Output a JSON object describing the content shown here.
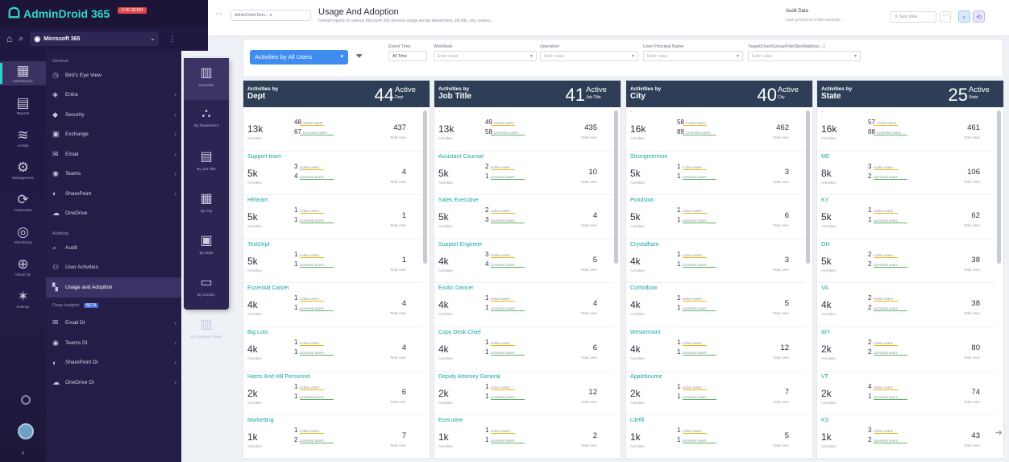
{
  "brand": {
    "name": "AdminDroid 365",
    "badge": "LIVE DEMO"
  },
  "tenant": {
    "name": "Microsoft 365"
  },
  "rail": [
    {
      "label": "Dashboards",
      "icon": "dashboard-icon",
      "glyph": "▦"
    },
    {
      "label": "Reports",
      "icon": "reports-icon",
      "glyph": "▤"
    },
    {
      "label": "Activity",
      "icon": "activity-icon",
      "glyph": "≋"
    },
    {
      "label": "Management",
      "icon": "management-icon",
      "glyph": "⚙"
    },
    {
      "label": "Automation",
      "icon": "automation-icon",
      "glyph": "⟳"
    },
    {
      "label": "Monitoring",
      "icon": "monitoring-icon",
      "glyph": "◎"
    },
    {
      "label": "Virtual DL",
      "icon": "virtual-dl-icon",
      "glyph": "⊕"
    },
    {
      "label": "Settings",
      "icon": "settings-icon",
      "glyph": "✶"
    }
  ],
  "menu": {
    "section1": "General",
    "items1": [
      {
        "label": "Bird's Eye View",
        "glyph": "◷",
        "arrow": false
      },
      {
        "label": "Entra",
        "glyph": "◈",
        "arrow": true
      },
      {
        "label": "Security",
        "glyph": "◆",
        "arrow": true
      },
      {
        "label": "Exchange",
        "glyph": "▣",
        "arrow": true
      },
      {
        "label": "Email",
        "glyph": "✉",
        "arrow": true
      },
      {
        "label": "Teams",
        "glyph": "◉",
        "arrow": true
      },
      {
        "label": "SharePoint",
        "glyph": "◐",
        "arrow": true
      },
      {
        "label": "OneDrive",
        "glyph": "☁",
        "arrow": false
      }
    ],
    "section2": "Auditing",
    "items2": [
      {
        "label": "Audit",
        "glyph": "⌕",
        "arrow": false
      },
      {
        "label": "User Activities",
        "glyph": "⚇",
        "arrow": false
      },
      {
        "label": "Usage and Adoption",
        "glyph": "▚",
        "arrow": false
      }
    ],
    "section3": "Deep Insights",
    "section3_badge": "BETA",
    "items3": [
      {
        "label": "Email DI",
        "glyph": "✉",
        "arrow": true
      },
      {
        "label": "Teams DI",
        "glyph": "◉",
        "arrow": true
      },
      {
        "label": "SharePoint DI",
        "glyph": "◐",
        "arrow": true
      },
      {
        "label": "OneDrive DI",
        "glyph": "☁",
        "arrow": true
      }
    ]
  },
  "flyout": [
    {
      "label": "Overview",
      "glyph": "▥"
    },
    {
      "label": "By Department",
      "glyph": "⛬"
    },
    {
      "label": "By Job Title",
      "glyph": "▤"
    },
    {
      "label": "By City",
      "glyph": "▦"
    },
    {
      "label": "By State",
      "glyph": "▣"
    },
    {
      "label": "By Country",
      "glyph": "▭"
    },
    {
      "label": "By Company Name",
      "glyph": "▥"
    }
  ],
  "header": {
    "nav": "‹ ›",
    "breadcrumb": "AdminDroid Dem... ▾",
    "title": "Usage And Adoption",
    "description": "Overall reports on various Microsoft 365 services usage across department, job title, city, country...",
    "audit_title": "Audit Data",
    "audit_sub": "Last synced on a few seconds ...",
    "sync_label": "⟳ Sync Now",
    "more": "⋯",
    "btn1": "⌕",
    "btn2": "⟲"
  },
  "filters": {
    "view": "Activities by All Users",
    "event_time": {
      "label": "Event Time",
      "value": "All Time"
    },
    "workload": {
      "label": "Workload",
      "placeholder": "Enter value"
    },
    "operation": {
      "label": "Operation",
      "placeholder": "Enter value"
    },
    "upn": {
      "label": "User Principal Name",
      "placeholder": "Enter value"
    },
    "target": {
      "label": "Target(User/Group/File/Site/Mailbox/...)",
      "placeholder": "Enter value"
    }
  },
  "cards": [
    {
      "title1": "Activities by",
      "title2": "Dept",
      "count": "44",
      "count_label": "Active",
      "count_sub": "Dept",
      "rows": [
        {
          "name": "-",
          "act": "13k",
          "au": "48",
          "lu": "67",
          "tu": "437"
        },
        {
          "name": "Support team",
          "act": "5k",
          "au": "3",
          "lu": "4",
          "tu": "4"
        },
        {
          "name": "HRteam",
          "act": "5k",
          "au": "1",
          "lu": "1",
          "tu": "1"
        },
        {
          "name": "TestDept",
          "act": "5k",
          "au": "1",
          "lu": "1",
          "tu": "1"
        },
        {
          "name": "Essential Carpet",
          "act": "4k",
          "au": "1",
          "lu": "1",
          "tu": "4"
        },
        {
          "name": "Big Lots",
          "act": "4k",
          "au": "1",
          "lu": "1",
          "tu": "4"
        },
        {
          "name": "Harris And Hill Personnel",
          "act": "2k",
          "au": "1",
          "lu": "1",
          "tu": "6"
        },
        {
          "name": "Marketting",
          "act": "1k",
          "au": "1",
          "lu": "2",
          "tu": "7"
        }
      ]
    },
    {
      "title1": "Activities by",
      "title2": "Job Title",
      "count": "41",
      "count_label": "Active",
      "count_sub": "Job Title",
      "rows": [
        {
          "name": "-",
          "act": "13k",
          "au": "49",
          "lu": "58",
          "tu": "435"
        },
        {
          "name": "Assistant Counsel",
          "act": "5k",
          "au": "2",
          "lu": "1",
          "tu": "10"
        },
        {
          "name": "Sales Executive",
          "act": "5k",
          "au": "2",
          "lu": "3",
          "tu": "4"
        },
        {
          "name": "Support Engineer",
          "act": "4k",
          "au": "3",
          "lu": "4",
          "tu": "5"
        },
        {
          "name": "Exotic Dancer",
          "act": "4k",
          "au": "1",
          "lu": "1",
          "tu": "4"
        },
        {
          "name": "Copy Desk Chief",
          "act": "4k",
          "au": "1",
          "lu": "1",
          "tu": "6"
        },
        {
          "name": "Deputy Attorney General",
          "act": "2k",
          "au": "1",
          "lu": "1",
          "tu": "12"
        },
        {
          "name": "Executive",
          "act": "1k",
          "au": "1",
          "lu": "1",
          "tu": "2"
        }
      ]
    },
    {
      "title1": "Activities by",
      "title2": "City",
      "count": "40",
      "count_label": "Active",
      "count_sub": "City",
      "rows": [
        {
          "name": "-",
          "act": "16k",
          "au": "58",
          "lu": "89",
          "tu": "462"
        },
        {
          "name": "Strongmermoe",
          "act": "5k",
          "au": "1",
          "lu": "1",
          "tu": "3"
        },
        {
          "name": "Pondston",
          "act": "5k",
          "au": "1",
          "lu": "1",
          "tu": "6"
        },
        {
          "name": "Crystalham",
          "act": "4k",
          "au": "1",
          "lu": "1",
          "tu": "3"
        },
        {
          "name": "Corholbow",
          "act": "4k",
          "au": "1",
          "lu": "1",
          "tu": "5"
        },
        {
          "name": "Westermont",
          "act": "4k",
          "au": "1",
          "lu": "1",
          "tu": "12"
        },
        {
          "name": "Applebourne",
          "act": "2k",
          "au": "1",
          "lu": "1",
          "tu": "7"
        },
        {
          "name": "Lilefill",
          "act": "1k",
          "au": "1",
          "lu": "1",
          "tu": "5"
        }
      ]
    },
    {
      "title1": "Activities by",
      "title2": "State",
      "count": "25",
      "count_label": "Active",
      "count_sub": "State",
      "rows": [
        {
          "name": "-",
          "act": "16k",
          "au": "57",
          "lu": "88",
          "tu": "461"
        },
        {
          "name": "ME",
          "act": "8k",
          "au": "3",
          "lu": "2",
          "tu": "106"
        },
        {
          "name": "KY",
          "act": "5k",
          "au": "1",
          "lu": "1",
          "tu": "62"
        },
        {
          "name": "OH",
          "act": "5k",
          "au": "2",
          "lu": "2",
          "tu": "38"
        },
        {
          "name": "VA",
          "act": "4k",
          "au": "2",
          "lu": "2",
          "tu": "38"
        },
        {
          "name": "WY",
          "act": "2k",
          "au": "2",
          "lu": "2",
          "tu": "80"
        },
        {
          "name": "VT",
          "act": "2k",
          "au": "4",
          "lu": "1",
          "tu": "74"
        },
        {
          "name": "KS",
          "act": "1k",
          "au": "3",
          "lu": "2",
          "tu": "43"
        }
      ]
    }
  ],
  "labels": {
    "activities": "Activities",
    "active_users": "Active users",
    "licensed_users": "Licensed users",
    "total_user": "Total User"
  }
}
